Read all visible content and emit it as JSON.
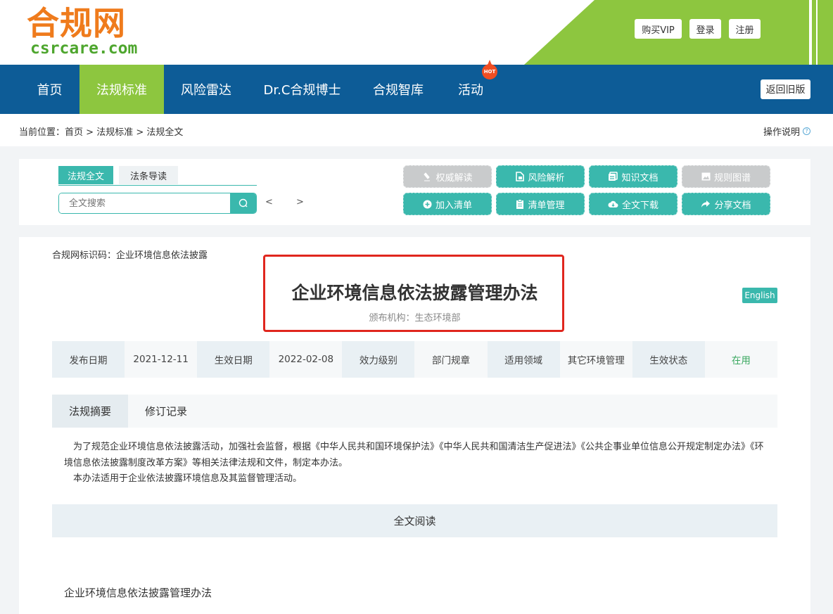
{
  "header": {
    "logo_cn": "合规网",
    "logo_en": "csrcare.com",
    "buttons": [
      "购买VIP",
      "登录",
      "注册"
    ]
  },
  "nav": {
    "items": [
      "首页",
      "法规标准",
      "风险雷达",
      "Dr.C合规博士",
      "合规智库",
      "活动"
    ],
    "active_index": 1,
    "hot_badge": "HOT",
    "old_version": "返回旧版"
  },
  "breadcrumb": {
    "prefix": "当前位置：",
    "items": [
      "首页",
      "法规标准",
      "法规全文"
    ],
    "separator": " > ",
    "help": "操作说明",
    "help_icon": "?"
  },
  "toolbar": {
    "tabs": [
      "法规全文",
      "法条导读"
    ],
    "search_placeholder": "全文搜索",
    "prev": "<",
    "next": ">",
    "buttons": [
      {
        "label": "权威解读",
        "icon": "flask-icon",
        "state": "disabled"
      },
      {
        "label": "风险解析",
        "icon": "document-icon",
        "state": "enabled"
      },
      {
        "label": "知识文档",
        "icon": "docs-icon",
        "state": "enabled"
      },
      {
        "label": "规则图谱",
        "icon": "image-icon",
        "state": "disabled"
      },
      {
        "label": "加入清单",
        "icon": "plus-circle-icon",
        "state": "enabled"
      },
      {
        "label": "清单管理",
        "icon": "clipboard-icon",
        "state": "enabled"
      },
      {
        "label": "全文下载",
        "icon": "cloud-download-icon",
        "state": "enabled"
      },
      {
        "label": "分享文档",
        "icon": "share-icon",
        "state": "enabled"
      }
    ]
  },
  "doc": {
    "id_label": "合规网标识码：企业环境信息依法披露",
    "title": "企业环境信息依法披露管理办法",
    "org": "颁布机构：生态环境部",
    "english": "English",
    "meta": [
      {
        "label": "发布日期",
        "value": "2021-12-11"
      },
      {
        "label": "生效日期",
        "value": "2022-02-08"
      },
      {
        "label": "效力级别",
        "value": "部门规章"
      },
      {
        "label": "适用领域",
        "value": "其它环境管理"
      },
      {
        "label": "生效状态",
        "value": "在用"
      }
    ],
    "sub_tabs": [
      "法规摘要",
      "修订记录"
    ],
    "summary": [
      "为了规范企业环境信息依法披露活动，加强社会监督，根据《中华人民共和国环境保护法》《中华人民共和国清洁生产促进法》《公共企事业单位信息公开规定制定办法》《环境信息依法披露制度改革方案》等相关法律法规和文件，制定本办法。",
      "本办法适用于企业依法披露环境信息及其监督管理活动。"
    ],
    "read_all": "全文阅读",
    "body_title": "企业环境信息依法披露管理办法"
  },
  "colors": {
    "nav_blue": "#0d5c97",
    "brand_green": "#8dc63f",
    "teal": "#3ab8ad",
    "logo_orange": "#ef7b1c",
    "highlight_red": "#e0261e",
    "status_green": "#3aa860"
  }
}
